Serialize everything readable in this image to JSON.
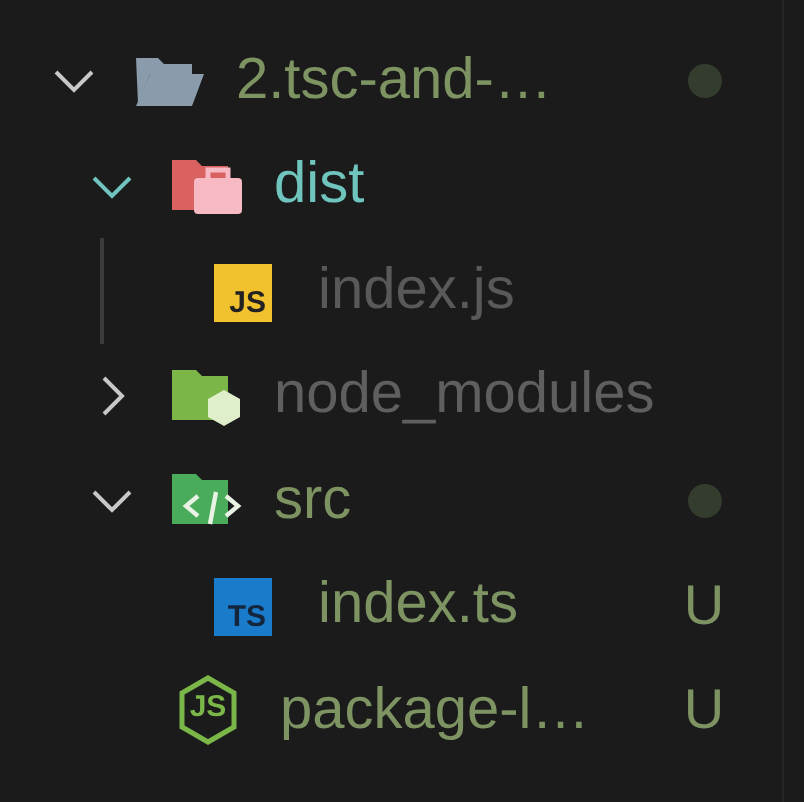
{
  "explorer": {
    "tree": [
      {
        "name": "2.tsc-and-…",
        "kind": "project",
        "expanded": true,
        "color": "#7d9462",
        "modified_dot": true,
        "children": [
          {
            "name": "dist",
            "kind": "build",
            "expanded": true,
            "color": "#6fc5bd",
            "guide": true,
            "children": [
              {
                "name": "index.js",
                "kind": "script",
                "icon_label": "JS",
                "color": "#595959"
              }
            ]
          },
          {
            "name": "node_modules",
            "kind": "packages",
            "expanded": false,
            "color": "#5f5f5f"
          },
          {
            "name": "src",
            "kind": "source",
            "expanded": true,
            "color": "#7d9462",
            "modified_dot": true,
            "children": [
              {
                "name": "index.ts",
                "kind": "typescript",
                "icon_label": "TS",
                "color": "#7d9462",
                "badge": "U"
              }
            ]
          },
          {
            "name": "package-l…",
            "kind": "nodejs",
            "icon_label": "JS",
            "color": "#7d9462",
            "badge": "U"
          }
        ]
      }
    ]
  }
}
